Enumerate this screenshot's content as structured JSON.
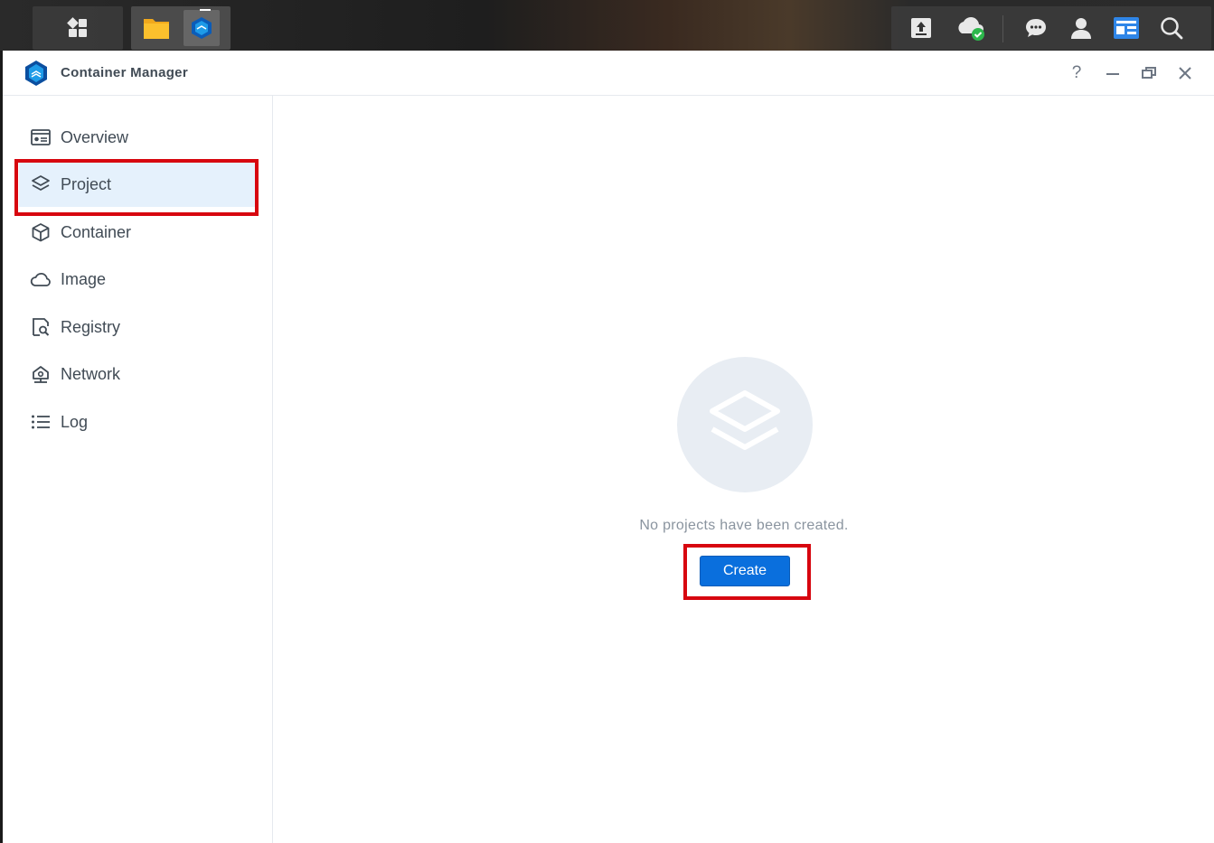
{
  "taskbar": {
    "left_icons": [
      "main-menu-icon"
    ],
    "app_icons": [
      "file-station-icon",
      "container-manager-icon"
    ],
    "right_icons": [
      "upload-icon",
      "cloud-sync-icon",
      "messages-icon",
      "user-icon",
      "widgets-icon",
      "search-icon"
    ]
  },
  "window": {
    "title": "Container Manager",
    "controls": {
      "help": "?"
    }
  },
  "sidebar": {
    "items": [
      {
        "label": "Overview",
        "icon": "overview-icon"
      },
      {
        "label": "Project",
        "icon": "project-icon",
        "selected": true
      },
      {
        "label": "Container",
        "icon": "container-icon"
      },
      {
        "label": "Image",
        "icon": "image-icon"
      },
      {
        "label": "Registry",
        "icon": "registry-icon"
      },
      {
        "label": "Network",
        "icon": "network-icon"
      },
      {
        "label": "Log",
        "icon": "log-icon"
      }
    ]
  },
  "main": {
    "empty_message": "No projects have been created.",
    "create_label": "Create"
  },
  "colors": {
    "accent": "#0a6fdd",
    "selected_bg": "#e5f1fc",
    "highlight": "#d7060f",
    "text": "#414b55",
    "muted_text": "#8a949f"
  }
}
